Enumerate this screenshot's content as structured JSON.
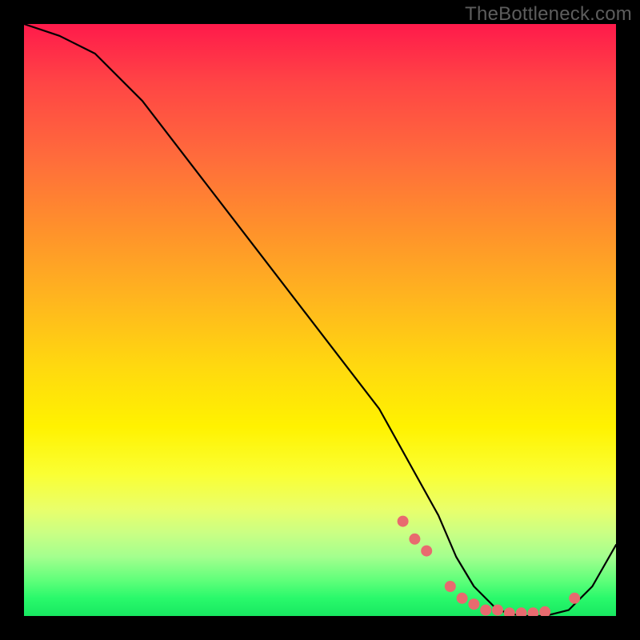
{
  "watermark": "TheBottleneck.com",
  "chart_data": {
    "type": "line",
    "title": "",
    "xlabel": "",
    "ylabel": "",
    "xlim": [
      0,
      100
    ],
    "ylim": [
      0,
      100
    ],
    "series": [
      {
        "name": "bottleneck-curve",
        "x": [
          0,
          6,
          12,
          20,
          30,
          40,
          50,
          60,
          65,
          70,
          73,
          76,
          80,
          84,
          88,
          92,
          96,
          100
        ],
        "values": [
          100,
          98,
          95,
          87,
          74,
          61,
          48,
          35,
          26,
          17,
          10,
          5,
          1,
          0,
          0,
          1,
          5,
          12
        ]
      }
    ],
    "markers": {
      "name": "highlight-dots",
      "color": "#e86a6f",
      "x": [
        64,
        66,
        68,
        72,
        74,
        76,
        78,
        80,
        82,
        84,
        86,
        88,
        93
      ],
      "values": [
        16,
        13,
        11,
        5,
        3,
        2,
        1,
        1,
        0.5,
        0.5,
        0.5,
        0.7,
        3
      ]
    }
  }
}
